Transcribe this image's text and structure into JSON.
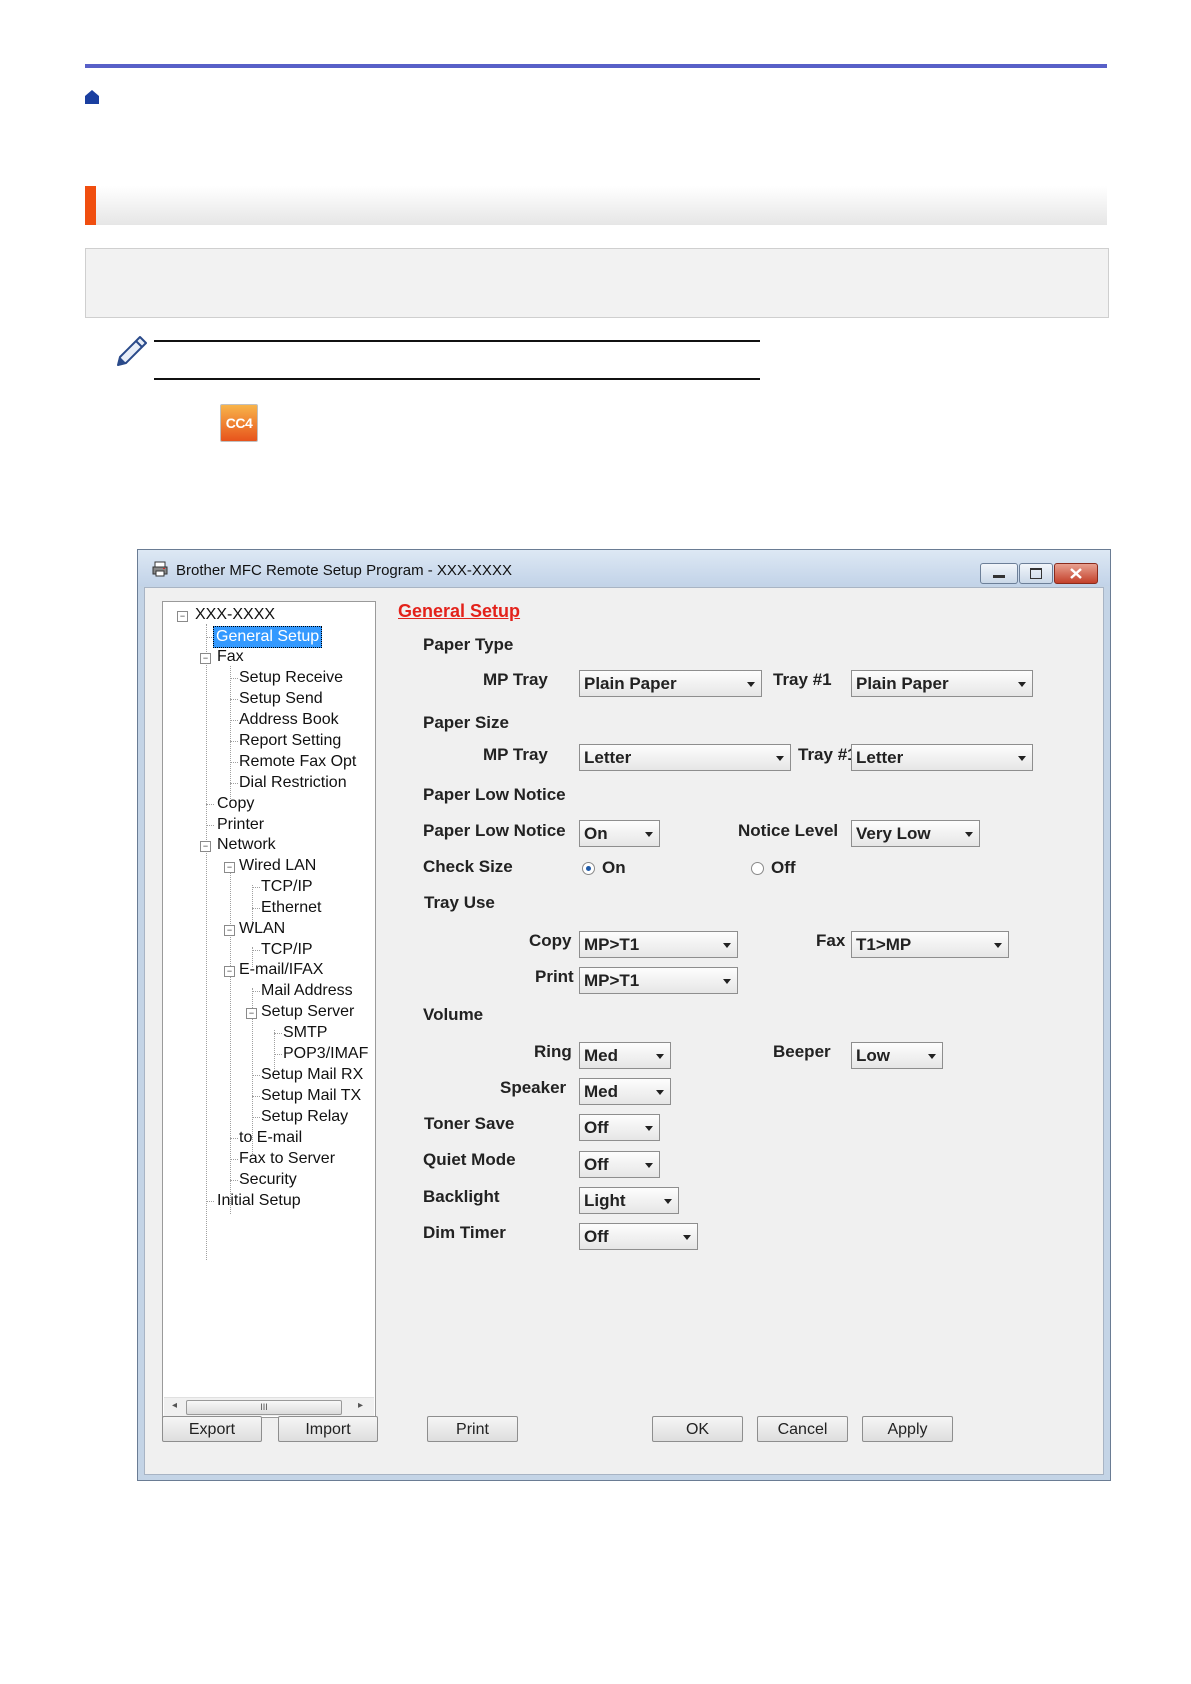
{
  "dialog": {
    "title": "Brother MFC Remote Setup Program - XXX-XXXX",
    "tree": {
      "root": "XXX-XXXX",
      "general_setup": "General Setup",
      "fax": "Fax",
      "setup_receive": "Setup Receive",
      "setup_send": "Setup Send",
      "address_book": "Address Book",
      "report_setting": "Report Setting",
      "remote_fax_opt": "Remote Fax Opt",
      "dial_restriction": "Dial Restriction",
      "copy": "Copy",
      "printer": "Printer",
      "network": "Network",
      "wired_lan": "Wired LAN",
      "wired_tcpip": "TCP/IP",
      "ethernet": "Ethernet",
      "wlan": "WLAN",
      "wlan_tcpip": "TCP/IP",
      "email_ifax": "E-mail/IFAX",
      "mail_address": "Mail Address",
      "setup_server": "Setup Server",
      "smtp": "SMTP",
      "pop3_imap": "POP3/IMAF",
      "setup_mail_rx": "Setup Mail RX",
      "setup_mail_tx": "Setup Mail TX",
      "setup_relay": "Setup Relay",
      "to_email": "to E-mail",
      "fax_to_server": "Fax to Server",
      "security": "Security",
      "initial_setup": "Initial Setup",
      "scroll_thumb": "III"
    },
    "panel": {
      "heading": "General Setup",
      "paper_type": "Paper Type",
      "mp_tray_label": "MP Tray",
      "tray1_label": "Tray #1",
      "paper_type_mp": "Plain Paper",
      "paper_type_tray1": "Plain Paper",
      "paper_size": "Paper Size",
      "paper_size_mp": "Letter",
      "paper_size_tray1": "Letter",
      "paper_low_notice_section": "Paper Low Notice",
      "paper_low_notice_label": "Paper Low Notice",
      "paper_low_notice_value": "On",
      "notice_level_label": "Notice Level",
      "notice_level_value": "Very Low",
      "check_size_label": "Check Size",
      "check_size_on": "On",
      "check_size_off": "Off",
      "check_size_selected": "On",
      "tray_use": "Tray Use",
      "copy_label": "Copy",
      "copy_value": "MP>T1",
      "fax_label": "Fax",
      "fax_value": "T1>MP",
      "print_label": "Print",
      "print_value": "MP>T1",
      "volume": "Volume",
      "ring_label": "Ring",
      "ring_value": "Med",
      "beeper_label": "Beeper",
      "beeper_value": "Low",
      "speaker_label": "Speaker",
      "speaker_value": "Med",
      "toner_save_label": "Toner Save",
      "toner_save_value": "Off",
      "quiet_mode_label": "Quiet Mode",
      "quiet_mode_value": "Off",
      "backlight_label": "Backlight",
      "backlight_value": "Light",
      "dim_timer_label": "Dim Timer",
      "dim_timer_value": "Off"
    },
    "buttons": {
      "export": "Export",
      "import": "Import",
      "print": "Print",
      "ok": "OK",
      "cancel": "Cancel",
      "apply": "Apply"
    }
  },
  "icons": {
    "cc4_label": "CC4"
  },
  "colors": {
    "top_rule": "#5860c8",
    "section_accent": "#f04e0f",
    "heading_red": "#e3221b",
    "selection_blue": "#3399ff"
  }
}
